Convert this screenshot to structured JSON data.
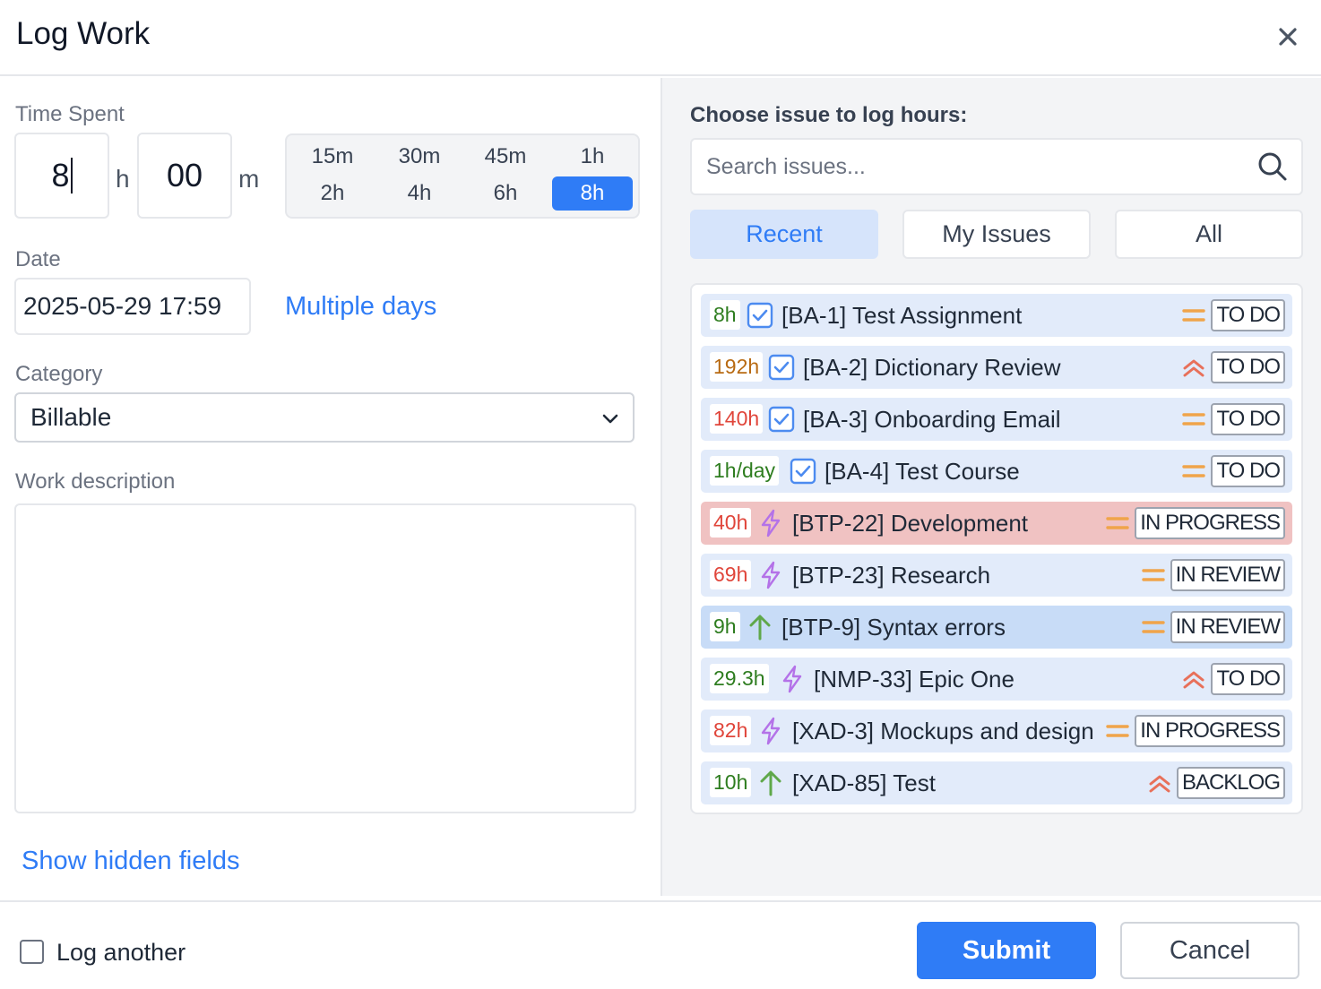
{
  "dialog": {
    "title": "Log Work"
  },
  "time_spent": {
    "label": "Time Spent",
    "hours_value": "8",
    "hours_unit": "h",
    "minutes_value": "00",
    "minutes_unit": "m",
    "presets": [
      "15m",
      "30m",
      "45m",
      "1h",
      "2h",
      "4h",
      "6h",
      "8h"
    ],
    "active_preset": "8h"
  },
  "date": {
    "label": "Date",
    "value": "2025-05-29 17:59",
    "multiple_days_link": "Multiple days"
  },
  "category": {
    "label": "Category",
    "value": "Billable"
  },
  "work_description": {
    "label": "Work description",
    "value": ""
  },
  "show_hidden_fields": "Show hidden fields",
  "issue_picker": {
    "label": "Choose issue to log hours:",
    "search_placeholder": "Search issues...",
    "tabs": [
      "Recent",
      "My Issues",
      "All"
    ],
    "active_tab": "Recent",
    "issues": [
      {
        "hours": "8h",
        "hours_color": "#2e7d1f",
        "type_icon": "checkbox-icon",
        "title": "[BA-1] Test Assignment",
        "priority_icon": "priority-medium-icon",
        "status": "TO DO"
      },
      {
        "hours": "192h",
        "hours_color": "#b86a12",
        "type_icon": "checkbox-icon",
        "title": "[BA-2] Dictionary Review",
        "priority_icon": "priority-high-icon",
        "status": "TO DO"
      },
      {
        "hours": "140h",
        "hours_color": "#e0453a",
        "type_icon": "checkbox-icon",
        "title": "[BA-3] Onboarding Email",
        "priority_icon": "priority-medium-icon",
        "status": "TO DO"
      },
      {
        "hours": "1h/day",
        "hours_color": "#2e7d1f",
        "type_icon": "checkbox-icon",
        "title": "[BA-4] Test Course",
        "priority_icon": "priority-medium-icon",
        "status": "TO DO"
      },
      {
        "hours": "40h",
        "hours_color": "#e0453a",
        "type_icon": "lightning-icon",
        "title": "[BTP-22] Development",
        "priority_icon": "priority-medium-icon",
        "status": "IN PROGRESS"
      },
      {
        "hours": "69h",
        "hours_color": "#e0453a",
        "type_icon": "lightning-icon",
        "title": "[BTP-23] Research",
        "priority_icon": "priority-medium-icon",
        "status": "IN REVIEW"
      },
      {
        "hours": "9h",
        "hours_color": "#2e7d1f",
        "type_icon": "arrow-up-icon",
        "title": "[BTP-9] Syntax errors",
        "priority_icon": "priority-medium-icon",
        "status": "IN REVIEW"
      },
      {
        "hours": "29.3h",
        "hours_color": "#2e7d1f",
        "type_icon": "lightning-icon",
        "title": "[NMP-33] Epic One",
        "priority_icon": "priority-high-icon",
        "status": "TO DO"
      },
      {
        "hours": "82h",
        "hours_color": "#e0453a",
        "type_icon": "lightning-icon",
        "title": "[XAD-3] Mockups and design",
        "priority_icon": "priority-medium-icon",
        "status": "IN PROGRESS"
      },
      {
        "hours": "10h",
        "hours_color": "#2e7d1f",
        "type_icon": "arrow-up-icon",
        "title": "[XAD-85] Test",
        "priority_icon": "priority-high-icon",
        "status": "BACKLOG"
      }
    ]
  },
  "footer": {
    "log_another_label": "Log another",
    "log_another_checked": false,
    "submit_label": "Submit",
    "cancel_label": "Cancel"
  },
  "colors": {
    "accent": "#2f7cf6",
    "row_default": "#e2ebfa",
    "row_highlight": "#f0c2c2",
    "row_selected": "#c8dcf7",
    "priority_medium": "#f0a44a",
    "priority_high": "#e8705a",
    "lightning": "#b472e8",
    "checkbox": "#4c8bf0",
    "arrow_up": "#5fa84a"
  }
}
